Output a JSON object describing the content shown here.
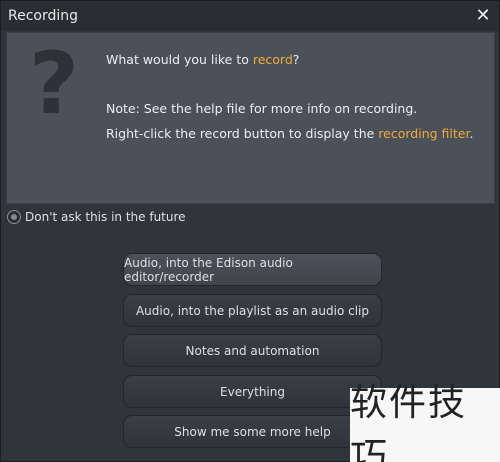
{
  "window": {
    "title": "Recording",
    "close_glyph": "✕"
  },
  "info": {
    "icon": "question-mark-icon",
    "icon_glyph": "?",
    "line1_prefix": "What would you like to ",
    "line1_link": "record",
    "line1_suffix": "?",
    "line2": "Note: See the help file for more info on recording.",
    "line3_prefix": "Right-click the record button to display the ",
    "line3_link": "recording filter",
    "line3_suffix": ".",
    "highlight_color": "#f2a73a"
  },
  "dont_ask": {
    "label": "Don't ask this in the future"
  },
  "options": [
    {
      "label": "Audio, into the Edison audio editor/recorder"
    },
    {
      "label": "Audio, into the playlist as an audio clip"
    },
    {
      "label": "Notes and automation"
    },
    {
      "label": "Everything"
    },
    {
      "label": "Show me some more help"
    }
  ],
  "watermark": {
    "text": "软件技巧"
  }
}
